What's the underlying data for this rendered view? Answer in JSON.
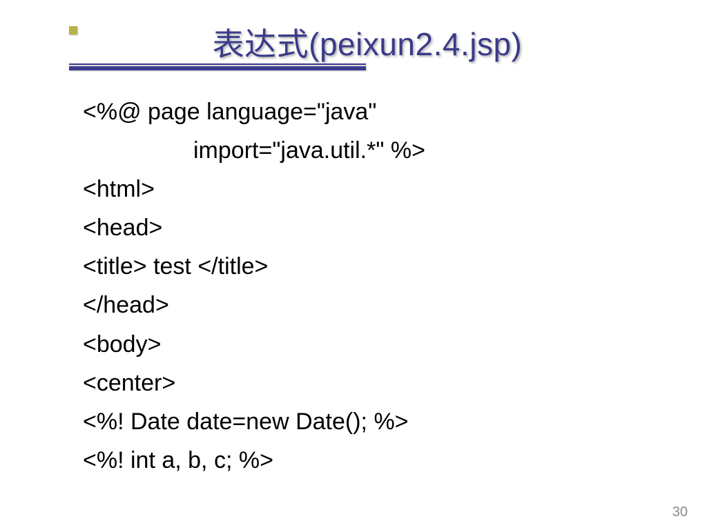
{
  "slide": {
    "title": "表达式(peixun2.4.jsp)",
    "code": {
      "l1": "<%@ page language=\"java\"",
      "l2": "import=\"java.util.*\" %>",
      "l3": "<html>",
      "l4": "<head>",
      "l5": "<title> test </title>",
      "l6": "</head>",
      "l7": "<body>",
      "l8": "<center>",
      "l9": "<%! Date date=new Date(); %>",
      "l10": "<%! int a, b, c; %>"
    },
    "page_number": "30"
  }
}
